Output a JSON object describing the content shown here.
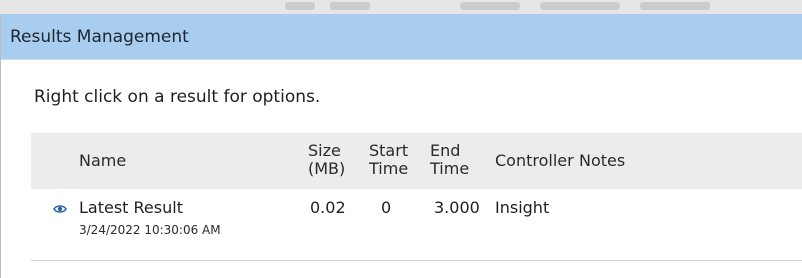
{
  "window": {
    "title": "Results Management"
  },
  "instruction": "Right click on a result for options.",
  "table": {
    "columns": {
      "name": "Name",
      "size_line1": "Size",
      "size_line2": "(MB)",
      "start_line1": "Start",
      "start_line2": "Time",
      "end_line1": "End",
      "end_line2": "Time",
      "controller": "Controller",
      "notes": "Notes"
    },
    "rows": [
      {
        "icon": "eye-icon",
        "name": "Latest Result",
        "date": "3/24/2022 10:30:06 AM",
        "size": "0.02",
        "start": "0",
        "end": "3.000",
        "controller": "Insight",
        "notes": ""
      }
    ]
  },
  "colors": {
    "titlebar": "#a9cdee",
    "header_bg": "#ececec",
    "eye_icon": "#2a64a8"
  }
}
